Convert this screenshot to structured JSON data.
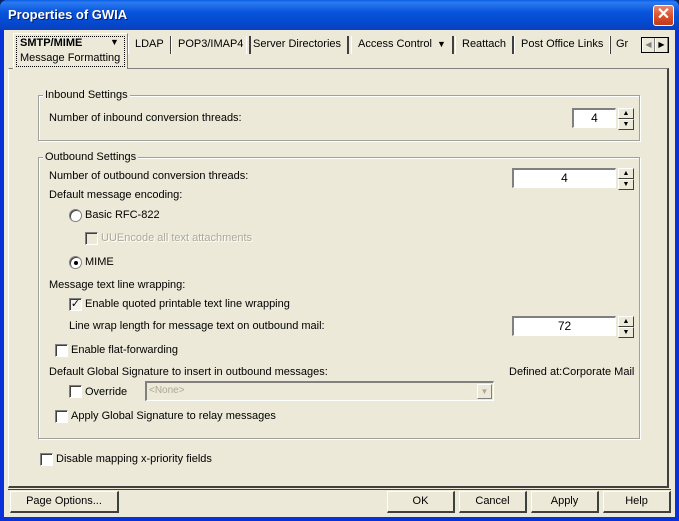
{
  "window": {
    "title": "Properties of GWIA",
    "close_icon": "close-icon"
  },
  "tabs": {
    "active": {
      "label": "SMTP/MIME",
      "sublabel": "Message Formatting",
      "has_dropdown": true
    },
    "items": [
      {
        "label": "LDAP"
      },
      {
        "label": "POP3/IMAP4"
      },
      {
        "label": "Server Directories"
      },
      {
        "label": "Access Control",
        "has_dropdown": true
      },
      {
        "label": "Reattach"
      },
      {
        "label": "Post Office Links"
      },
      {
        "label": "Gr"
      }
    ],
    "scroll_left_icon": "◀",
    "scroll_right_icon": "▶",
    "dropdown_glyph": "▼"
  },
  "inbound": {
    "legend": "Inbound Settings",
    "threads_label": "Number of inbound conversion threads:",
    "threads_value": "4"
  },
  "outbound": {
    "legend": "Outbound Settings",
    "threads_label": "Number of outbound conversion threads:",
    "threads_value": "4",
    "encoding_label": "Default message encoding:",
    "encoding_options": [
      {
        "label": "Basic RFC-822",
        "selected": false
      },
      {
        "label": "MIME",
        "selected": true
      }
    ],
    "uuencode_label": "UUEncode all text attachments",
    "uuencode_checked": false,
    "wrapping_label": "Message text line wrapping:",
    "enable_qp_label": "Enable quoted printable text line wrapping",
    "enable_qp_checked": true,
    "wrap_length_label": "Line wrap length for message text on outbound mail:",
    "wrap_length_value": "72",
    "flat_forwarding_label": "Enable flat-forwarding",
    "flat_forwarding_checked": false,
    "signature_label": "Default Global Signature to insert in outbound messages:",
    "defined_at": "Defined at:Corporate Mail",
    "override_label": "Override",
    "override_checked": false,
    "signature_value": "<None>",
    "apply_relay_label": "Apply Global Signature to relay messages",
    "apply_relay_checked": false
  },
  "disable_mapping": {
    "label": "Disable mapping x-priority fields",
    "checked": false
  },
  "buttons": {
    "page_options": "Page Options...",
    "ok": "OK",
    "cancel": "Cancel",
    "apply": "Apply",
    "help": "Help"
  },
  "glyphs": {
    "check": "✓",
    "spin_up": "▲",
    "spin_down": "▼",
    "combo_drop": "▼"
  }
}
